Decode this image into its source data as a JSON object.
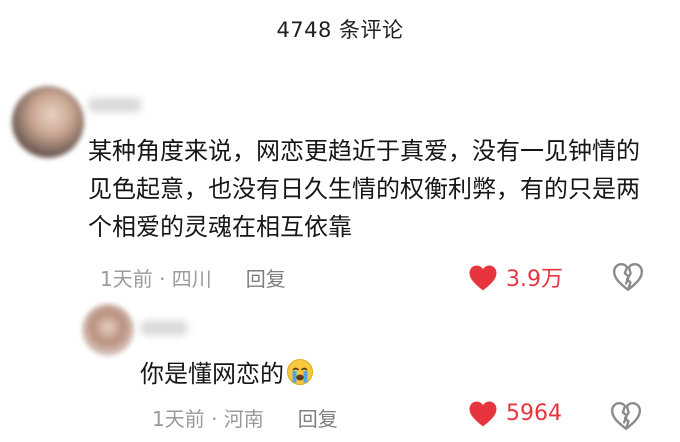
{
  "header": {
    "title": "4748 条评论"
  },
  "comments": [
    {
      "text": "某种角度来说，网恋更趋近于真爱，没有一见钟情的见色起意，也没有日久生情的权衡利弊，有的只是两个相爱的灵魂在相互依靠",
      "time_location": "1天前 · 四川",
      "reply_label": "回复",
      "likes": "3.9万",
      "liked": true
    },
    {
      "text": "你是懂网恋的",
      "emoji": "crying-face-icon",
      "time_location": "1天前 · 河南",
      "reply_label": "回复",
      "likes": "5964",
      "liked": true
    }
  ],
  "colors": {
    "like_red": "#e8343f",
    "meta_gray": "#9b9b9b",
    "text": "#161616"
  }
}
